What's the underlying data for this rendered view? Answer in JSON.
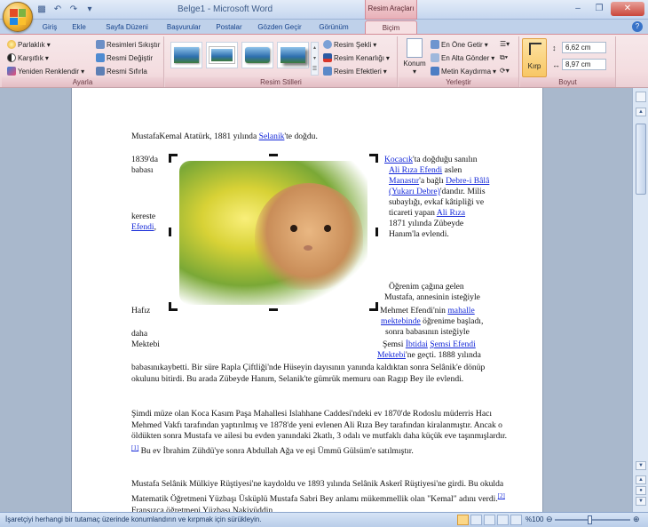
{
  "window": {
    "title": "Belge1 - Microsoft Word",
    "context_tab_title": "Resim Araçları"
  },
  "tabs": [
    "Giriş",
    "Ekle",
    "Sayfa Düzeni",
    "Başvurular",
    "Postalar",
    "Gözden Geçir",
    "Görünüm",
    "Biçim"
  ],
  "active_tab": "Biçim",
  "ribbon": {
    "ayarla": {
      "label": "Ayarla",
      "parlaklik": "Parlaklık",
      "karsitlik": "Karşıtlık",
      "yeniden_renklendir": "Yeniden Renklendir",
      "resimleri_sikistir": "Resimleri Sıkıştır",
      "resmi_degistir": "Resmi Değiştir",
      "resmi_sifirla": "Resmi Sıfırla"
    },
    "resim_stilleri": {
      "label": "Resim Stilleri",
      "resim_sekli": "Resim Şekli",
      "resim_kenarligi": "Resim Kenarlığı",
      "resim_efektleri": "Resim Efektleri"
    },
    "yerlestir": {
      "label": "Yerleştir",
      "konum": "Konum",
      "en_one_getir": "En Öne Getir",
      "en_alta_gonder": "En Alta Gönder",
      "metin_kaydirma": "Metin Kaydırma"
    },
    "boyut": {
      "label": "Boyut",
      "kirp": "Kırp",
      "height": "6,62 cm",
      "width": "8,97 cm"
    }
  },
  "document": {
    "line1_a": "MustafaKemal Atatürk, 1881 yılında ",
    "line1_link": "Selanik",
    "line1_b": "'te doğdu.",
    "left_col": {
      "l1": "1839'da",
      "l2": "babası",
      "l3": "kereste",
      "l4_link": "Efendi",
      "l4_tail": ",",
      "l5": "Hafız",
      "l6": "daha",
      "l7": "Mektebi"
    },
    "right_col": {
      "r1_link": "Kocacık",
      "r1_tail": "'ta doğduğu sanılın",
      "r2_link": "Ali Rıza Efendi",
      "r2_tail": " aslen",
      "r3_link1": "Manastır",
      "r3_mid": "'a bağlı ",
      "r3_link2": "Debre-i Bâlâ",
      "r4_link": "(Yukarı Debre)",
      "r4_tail": "'dandır. Milis",
      "r5": "subaylığı, evkaf kâtipliği ve",
      "r6_a": "ticareti yapan ",
      "r6_link": "Ali Rıza",
      "r7": "1871 yılında Zübeyde",
      "r8": "Hanım'la evlendi.",
      "r9": "Öğrenim çağına gelen",
      "r10": "Mustafa, annesinin isteğiyle",
      "r11_a": "Mehmet Efendi'nin ",
      "r11_link": "mahalle",
      "r12_link": "mektebinde",
      "r12_tail": " öğrenime başladı,",
      "r13": "sonra babasının isteğiyle",
      "r14_a": "Şemsi ",
      "r14_link1": "İbtidai",
      "r14_sp": " ",
      "r14_link2": "Şemsi Efendi",
      "r15_link": "Mektebi",
      "r15_tail": "'ne geçti. 1888 yılında"
    },
    "para2": "babasınıkaybetti. Bir süre Rapla Çiftliği'nde Hüseyin dayısının yanında kaldıktan sonra Selânik'e dönüp okulunu bitirdi. Bu arada Zübeyde Hanım, Selanik'te gümrük memuru oan Ragıp Bey ile evlendi.",
    "para3_a": "Şimdi müze olan Koca Kasım Paşa Mahallesi  Islahhane Caddesi'ndeki ev 1870'de Rodoslu müderris Hacı Mehmed Vakfı tarafından yaptırılmış  ve 1878'de yeni evlenen Ali Rıza Bey tarafından kiralanmıştır.  Ancak o öldükten sonra Mustafa ve ailesi  bu evden yanındaki 2katlı, 3 odalı ve mutfaklı daha küçük eve taşınmışlardır.",
    "para3_ref": "[1]",
    "para3_b": " Bu ev İbrahim Zühdü'ye sonra Abdullah Ağa ve eşi Ümmü Gülsüm'e satılmıştır.",
    "para4_a": "Mustafa Selânik Mülkiye Rüştiyesi'ne kaydoldu ve 1893 yılında Selânik Askerî Rüştiyesi'ne girdi. Bu okulda Matematik Öğretmeni Yüzbaşı Üsküplü Mustafa Sabri Bey anlamı mükemmellik  olan \"Kemal\" adını verdi.",
    "para4_ref": "[2]",
    "para4_b": " Fransızca öğretmeni Yüzbaşı Nakiyüddin"
  },
  "statusbar": {
    "message": "İşaretçiyi herhangi bir tutamaç üzerinde konumlandırın ve kırpmak için sürükleyin.",
    "zoom": "%100"
  }
}
